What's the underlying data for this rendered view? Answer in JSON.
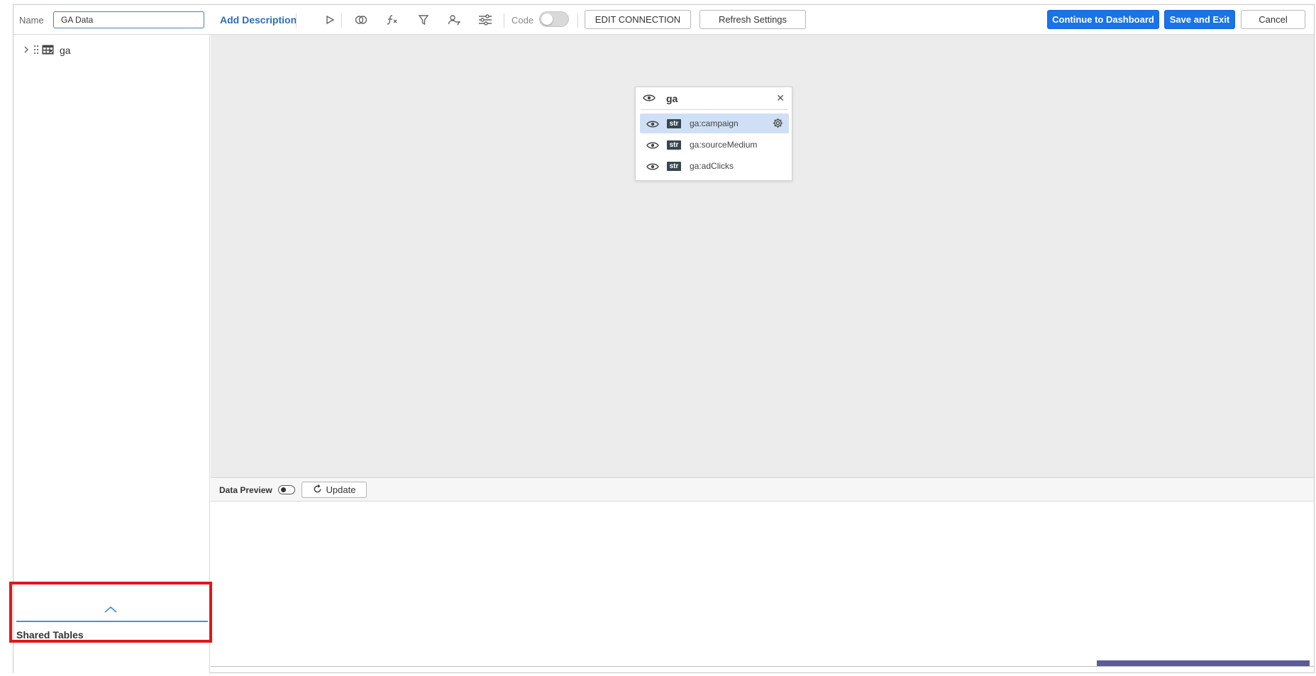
{
  "toolbar": {
    "name_label": "Name",
    "name_value": "GA Data",
    "add_description": "Add Description",
    "code_label": "Code",
    "edit_connection": "EDIT CONNECTION",
    "refresh_settings": "Refresh Settings",
    "continue_dashboard": "Continue to Dashboard",
    "save_exit": "Save and Exit",
    "cancel": "Cancel",
    "icons": [
      "play-icon",
      "join-icon",
      "formula-icon",
      "filter-icon",
      "user-filter-icon",
      "sliders-icon"
    ],
    "code_enabled": false
  },
  "sidebar": {
    "tree": [
      {
        "label": "ga",
        "expanded": false,
        "icon": "table-icon"
      }
    ],
    "shared_tables_label": "Shared Tables"
  },
  "canvas": {
    "node": {
      "title": "ga",
      "fields": [
        {
          "type": "str",
          "name": "ga:campaign",
          "selected": true
        },
        {
          "type": "str",
          "name": "ga:sourceMedium",
          "selected": false
        },
        {
          "type": "str",
          "name": "ga:adClicks",
          "selected": false
        }
      ]
    }
  },
  "preview": {
    "label": "Data Preview",
    "update_label": "Update",
    "enabled": false
  },
  "colors": {
    "accent": "#1a73e8",
    "link": "#2a6ebb",
    "highlight": "#e0161b",
    "selected_row": "#cfe0f6",
    "canvas_bg": "#ececec"
  }
}
